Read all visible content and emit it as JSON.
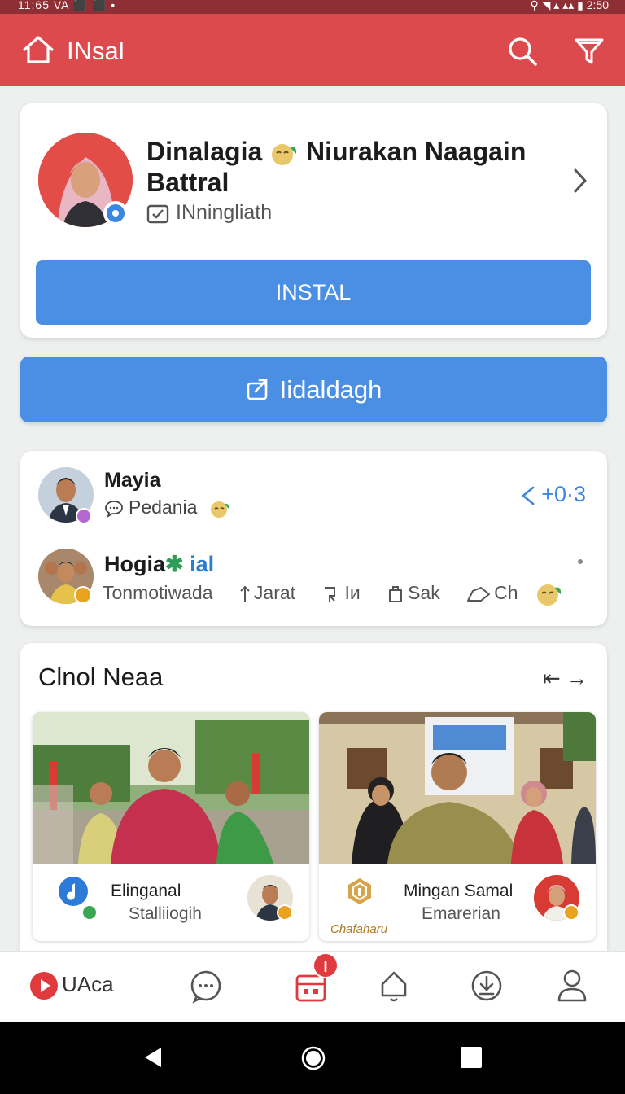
{
  "status_bar": {
    "left": "11:65  VA  ⬛  ⬛  •",
    "right": "⚲  ◥  ▴  ▴▴  ▮  2:50"
  },
  "app_bar": {
    "title": "INsal",
    "icons": [
      "home-icon",
      "search-icon",
      "filter-icon"
    ]
  },
  "profile": {
    "name": "Dinalagia",
    "name_suffix": "Niurakan Naagain Battral",
    "subtitle": "INningliath",
    "install_label": "INSTAL"
  },
  "share_button": {
    "label": "Iidaldagh"
  },
  "feed": {
    "row1": {
      "name": "Mayia",
      "sub": "Pedania",
      "score": "+0·3"
    },
    "row2": {
      "name": "Hogia",
      "tag": "ial",
      "sub": "Tonmotiwada",
      "actions": [
        "Jarat",
        "Iи",
        "Sak",
        "Ch"
      ]
    }
  },
  "news": {
    "title": "Clnol Neaa",
    "nav_icon": "⇤ →",
    "items": [
      {
        "name": "Elinganal",
        "sub": "Stalliiogih"
      },
      {
        "name": "Mingan Samal",
        "sub": "Emarerian",
        "brand": "Chafaharu"
      }
    ]
  },
  "bottom_nav": {
    "brand": "UAca",
    "badge": "I",
    "items": [
      "chat-icon",
      "calendar-icon",
      "notification-icon",
      "download-icon",
      "profile-icon"
    ]
  },
  "colors": {
    "appbar": "#dd4a4e",
    "primary": "#4a8fe3",
    "accent_blue": "#3b86e0",
    "badge_red": "#e03a3e"
  }
}
